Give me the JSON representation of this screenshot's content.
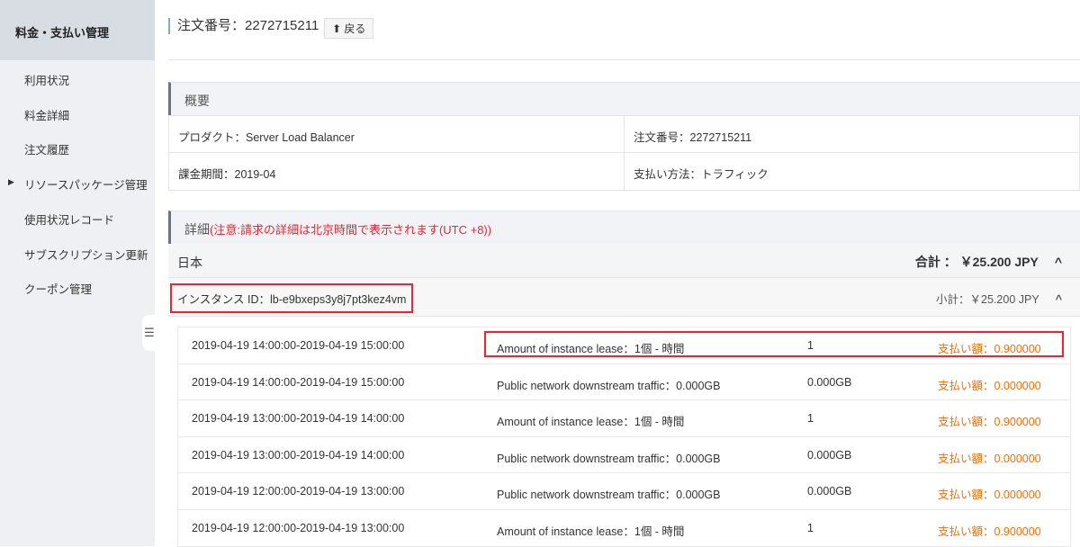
{
  "sidebar": {
    "title": "料金・支払い管理",
    "items": [
      "利用状況",
      "料金詳細",
      "注文履歴",
      "リソースパッケージ管理",
      "使用状況レコード",
      "サブスクリプション更新",
      "クーポン管理"
    ]
  },
  "header": {
    "title": "注文番号：2272715211",
    "back": "戻る"
  },
  "overview": {
    "title": "概要",
    "product": "プロダクト：Server Load Balancer",
    "order": "注文番号：2272715211",
    "period": "課金期間：2019-04",
    "payment": "支払い方法：トラフィック"
  },
  "detail": {
    "title": "詳細",
    "note": "(注意:請求の詳細は北京時間で表示されます(UTC +8))",
    "region": "日本",
    "total": "合計 ： ￥25.200 JPY",
    "instance": "インスタンス ID：lb-e9bxeps3y8j7pt3kez4vm",
    "subtotal": "小計：￥25.200 JPY",
    "rows": [
      {
        "time": "2019-04-19 14:00:00-2019-04-19 15:00:00",
        "desc": "Amount of instance lease：1個 - 時間",
        "qty": "1",
        "amount": "支払い額：0.900000"
      },
      {
        "time": "2019-04-19 14:00:00-2019-04-19 15:00:00",
        "desc": "Public network downstream traffic：0.000GB",
        "qty": "0.000GB",
        "amount": "支払い額：0.000000"
      },
      {
        "time": "2019-04-19 13:00:00-2019-04-19 14:00:00",
        "desc": "Amount of instance lease：1個 - 時間",
        "qty": "1",
        "amount": "支払い額：0.900000"
      },
      {
        "time": "2019-04-19 13:00:00-2019-04-19 14:00:00",
        "desc": "Public network downstream traffic：0.000GB",
        "qty": "0.000GB",
        "amount": "支払い額：0.000000"
      },
      {
        "time": "2019-04-19 12:00:00-2019-04-19 13:00:00",
        "desc": "Public network downstream traffic：0.000GB",
        "qty": "0.000GB",
        "amount": "支払い額：0.000000"
      },
      {
        "time": "2019-04-19 12:00:00-2019-04-19 13:00:00",
        "desc": "Amount of instance lease：1個 - 時間",
        "qty": "1",
        "amount": "支払い額：0.900000"
      }
    ]
  }
}
